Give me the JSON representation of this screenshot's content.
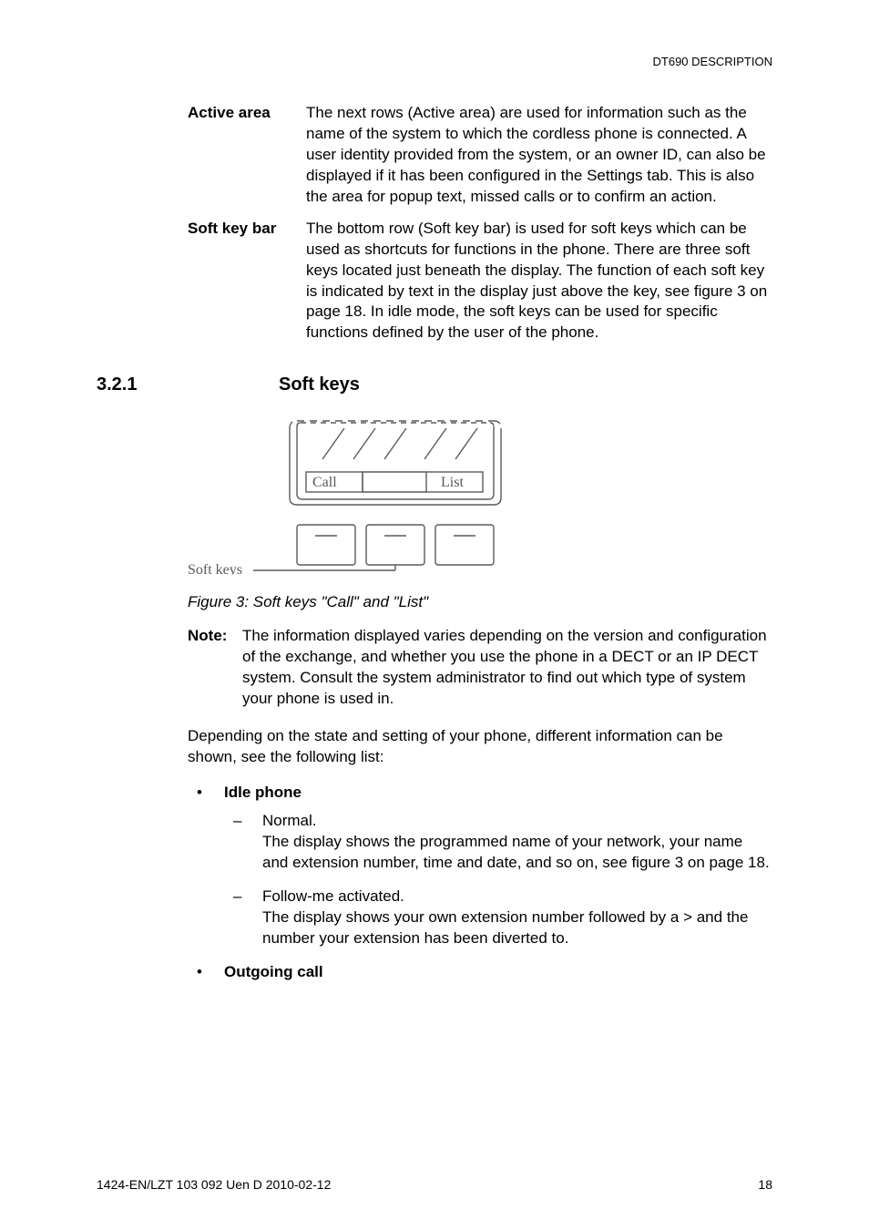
{
  "running_head": "DT690 DESCRIPTION",
  "definitions": [
    {
      "term": "Active area",
      "text": "The next rows (Active area) are used for information such as the name of the system to which the cordless phone is connected. A user identity provided from the system, or an owner ID, can also be displayed if it has been configured in the Settings tab. This is also the area for popup text, missed calls or to confirm an action."
    },
    {
      "term": "Soft key bar",
      "text": "The bottom row (Soft key bar) is used for soft keys which can be used as shortcuts for functions in the phone. There are three soft keys located just beneath the display. The function of each soft key is indicated by text in the display just above the key, see figure 3 on page 18. In idle mode, the soft keys can be used for specific functions defined by the user of the phone."
    }
  ],
  "section": {
    "number": "3.2.1",
    "title": "Soft keys"
  },
  "figure": {
    "side_label": "Soft keys",
    "softkey_labels": {
      "left": "Call",
      "right": "List"
    },
    "caption": "Figure 3:  Soft keys \"Call\" and \"List\""
  },
  "note": {
    "label": "Note:",
    "body": "The information displayed varies depending on the version and configuration of the exchange, and whether you use the phone in a DECT or an IP DECT system. Consult the system administrator to find out which type of system your phone is used in."
  },
  "para_after_note": "Depending on the state and setting of your phone, different information can be shown, see the following list:",
  "list": {
    "idle": {
      "head": "Idle phone",
      "items": [
        {
          "title": "Normal.",
          "body": "The display shows the programmed name of your network, your name and extension number, time and date, and so on, see figure 3 on page 18."
        },
        {
          "title": "Follow-me activated.",
          "body": "The display shows your own extension number followed by a > and the number your extension has been diverted to."
        }
      ]
    },
    "outgoing": {
      "head": "Outgoing call"
    }
  },
  "footer": {
    "left": "1424-EN/LZT 103 092 Uen D 2010-02-12",
    "right": "18"
  }
}
